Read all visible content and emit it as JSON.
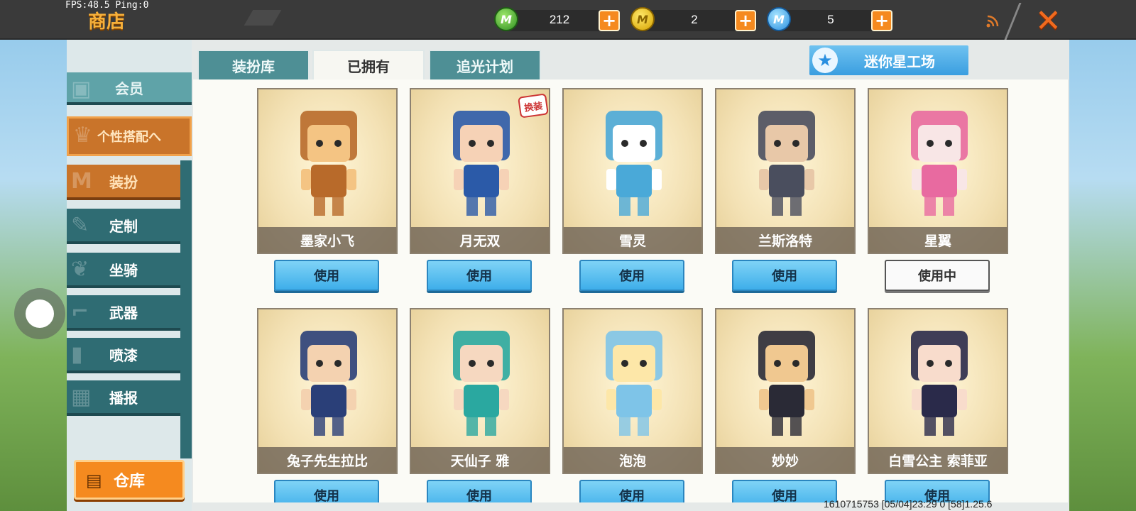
{
  "hud": {
    "fps": "FPS:48.5  Ping:0",
    "title": "商店"
  },
  "currencies": [
    {
      "icon": "green-mini-coin-icon",
      "value": "212"
    },
    {
      "icon": "gold-mini-coin-icon",
      "value": "2"
    },
    {
      "icon": "blue-mini-coin-icon",
      "value": "5"
    }
  ],
  "sidebar": {
    "member": "会员",
    "group": "个性搭配へ",
    "items": [
      "装扮",
      "定制",
      "坐骑",
      "武器",
      "喷漆",
      "播报"
    ],
    "warehouse": "仓库"
  },
  "tabs": [
    "装扮库",
    "已拥有",
    "追光计划"
  ],
  "active_tab": "已拥有",
  "mini_workshop": "迷你星工场",
  "badge": "换装",
  "cards": [
    {
      "name": "墨家小飞",
      "button": "使用",
      "color": "#b86a2a",
      "skin": "#f4c483"
    },
    {
      "name": "月无双",
      "button": "使用",
      "color": "#2b5aa8",
      "skin": "#f6d2b6"
    },
    {
      "name": "雪灵",
      "button": "使用",
      "color": "#4aa9d8",
      "skin": "#ffffff"
    },
    {
      "name": "兰斯洛特",
      "button": "使用",
      "color": "#4a4e5e",
      "skin": "#e8c8a8"
    },
    {
      "name": "星翼",
      "button": "使用中",
      "color": "#e86aa0",
      "skin": "#f8e6e6"
    },
    {
      "name": "兔子先生拉比",
      "button": "使用",
      "color": "#2a3f78",
      "skin": "#f4d2b0"
    },
    {
      "name": "天仙子 雅",
      "button": "使用",
      "color": "#2aa8a0",
      "skin": "#f6d8c0"
    },
    {
      "name": "泡泡",
      "button": "使用",
      "color": "#7ec4e8",
      "skin": "#fde7a8"
    },
    {
      "name": "妙妙",
      "button": "使用",
      "color": "#2a2a36",
      "skin": "#f0c890"
    },
    {
      "name": "白雪公主 索菲亚",
      "button": "使用",
      "color": "#2a2a4a",
      "skin": "#f8dccc"
    }
  ],
  "footer": "1610715753     [05/04]23:29 0  [58]1.25.6"
}
